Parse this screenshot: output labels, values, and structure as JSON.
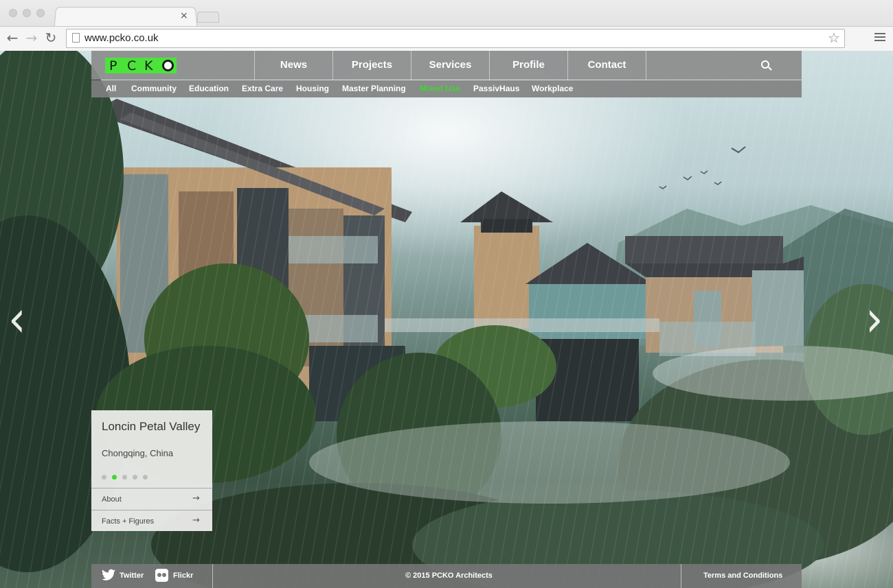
{
  "browser": {
    "url": "www.pcko.co.uk",
    "tab_close": "×",
    "icons": {
      "back": "back-arrow-icon",
      "forward": "forward-arrow-icon",
      "reload": "reload-icon",
      "bookmark": "star-icon",
      "menu": "hamburger-menu-icon"
    }
  },
  "site": {
    "logo": {
      "letters": [
        "P",
        "C",
        "K"
      ],
      "color": "#4be33a"
    },
    "nav": [
      "News",
      "Projects",
      "Services",
      "Profile",
      "Contact"
    ],
    "subnav": [
      "All",
      "Community",
      "Education",
      "Extra Care",
      "Housing",
      "Master Planning",
      "Mixed Use",
      "PassivHaus",
      "Workplace"
    ],
    "subnav_active": "Mixed Use",
    "accent": "#3fd62f"
  },
  "slider": {
    "prev": "‹",
    "next": "›"
  },
  "card": {
    "title": "Loncin Petal Valley",
    "location": "Chongqing, China",
    "slides_total": 5,
    "slide_active": 2,
    "rows": [
      "About",
      "Facts + Figures"
    ],
    "arrow": "→"
  },
  "footer": {
    "twitter": "Twitter",
    "flickr": "Flickr",
    "copyright": "© 2015 PCKO Architects",
    "terms": "Terms and Conditions"
  }
}
